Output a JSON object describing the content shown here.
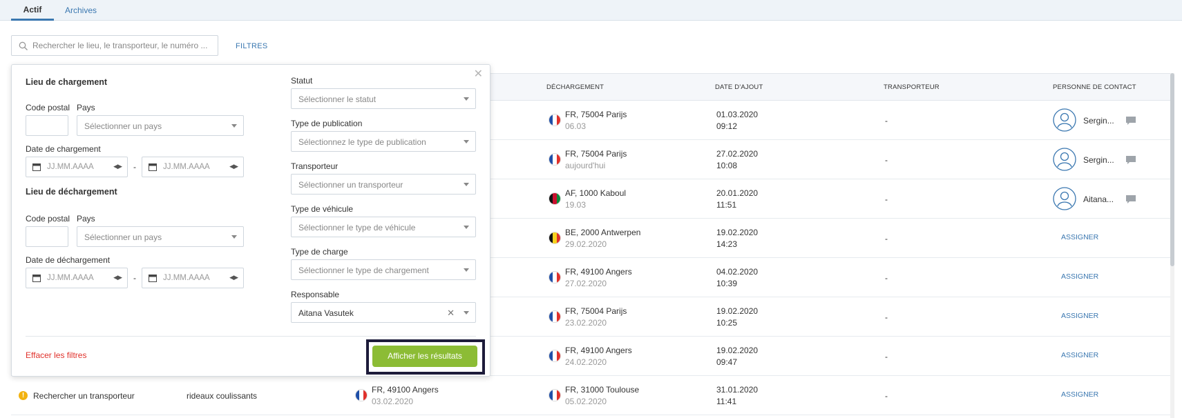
{
  "tabs": [
    {
      "label": "Actif",
      "active": true
    },
    {
      "label": "Archives",
      "active": false
    }
  ],
  "search": {
    "placeholder": "Rechercher le lieu, le transporteur, le numéro ..."
  },
  "filters_link": "FILTRES",
  "table": {
    "headers": {
      "dechargement": "DÉCHARGEMENT",
      "date_ajout": "DATE D'AJOUT",
      "transporteur": "TRANSPORTEUR",
      "contact": "PERSONNE DE CONTACT"
    },
    "rows": [
      {
        "unload_main": "FR, 75004 Parijs",
        "unload_sub": "06.03",
        "flag": "fr",
        "date": "01.03.2020",
        "time": "09:12",
        "carrier": "-",
        "contact": "Sergin...",
        "assign": null
      },
      {
        "unload_main": "FR, 75004 Parijs",
        "unload_sub": "aujourd'hui",
        "flag": "fr",
        "date": "27.02.2020",
        "time": "10:08",
        "carrier": "-",
        "contact": "Sergin...",
        "assign": null
      },
      {
        "unload_main": "AF, 1000 Kaboul",
        "unload_sub": "19.03",
        "flag": "af",
        "date": "20.01.2020",
        "time": "11:51",
        "carrier": "-",
        "contact": "Aitana...",
        "assign": null
      },
      {
        "unload_main": "BE, 2000 Antwerpen",
        "unload_sub": "29.02.2020",
        "flag": "be",
        "date": "19.02.2020",
        "time": "14:23",
        "carrier": "-",
        "contact": null,
        "assign": "ASSIGNER"
      },
      {
        "unload_main": "FR, 49100 Angers",
        "unload_sub": "27.02.2020",
        "flag": "fr",
        "date": "04.02.2020",
        "time": "10:39",
        "carrier": "-",
        "contact": null,
        "assign": "ASSIGNER"
      },
      {
        "unload_main": "FR, 75004 Parijs",
        "unload_sub": "23.02.2020",
        "flag": "fr",
        "date": "19.02.2020",
        "time": "10:25",
        "carrier": "-",
        "contact": null,
        "assign": "ASSIGNER"
      },
      {
        "unload_main": "FR, 49100 Angers",
        "unload_sub": "24.02.2020",
        "flag": "fr",
        "date": "19.02.2020",
        "time": "09:47",
        "carrier": "-",
        "contact": null,
        "assign": "ASSIGNER"
      },
      {
        "status": "Rechercher un transporteur",
        "vehicle": "rideaux coulissants",
        "load_main": "FR, 49100 Angers",
        "load_sub": "03.02.2020",
        "unload_main": "FR, 31000 Toulouse",
        "unload_sub": "05.02.2020",
        "flag": "fr",
        "date": "31.01.2020",
        "time": "11:41",
        "carrier": "-",
        "contact": null,
        "assign": "ASSIGNER"
      }
    ]
  },
  "filter_panel": {
    "loading_title": "Lieu de chargement",
    "unloading_title": "Lieu de déchargement",
    "postal_code_label": "Code postal",
    "country_label": "Pays",
    "country_placeholder": "Sélectionner un pays",
    "loading_date_label": "Date de chargement",
    "unloading_date_label": "Date de déchargement",
    "date_placeholder": "JJ.MM.AAAA",
    "date_separator": "-",
    "statut_label": "Statut",
    "statut_placeholder": "Sélectionner le statut",
    "publication_label": "Type de publication",
    "publication_placeholder": "Sélectionnez le type de publication",
    "transporteur_label": "Transporteur",
    "transporteur_placeholder": "Sélectionner un transporteur",
    "vehicule_label": "Type de véhicule",
    "vehicule_placeholder": "Sélectionner le type de véhicule",
    "charge_label": "Type de charge",
    "charge_placeholder": "Sélectionner le type de chargement",
    "responsable_label": "Responsable",
    "responsable_value": "Aitana Vasutek",
    "clear_filters": "Effacer les filtres",
    "show_results": "Afficher les résultats"
  },
  "colors": {
    "accent": "#3a77b0",
    "green_button": "#8cbc35",
    "danger": "#e0312b",
    "highlight": "#1d1b3a"
  }
}
